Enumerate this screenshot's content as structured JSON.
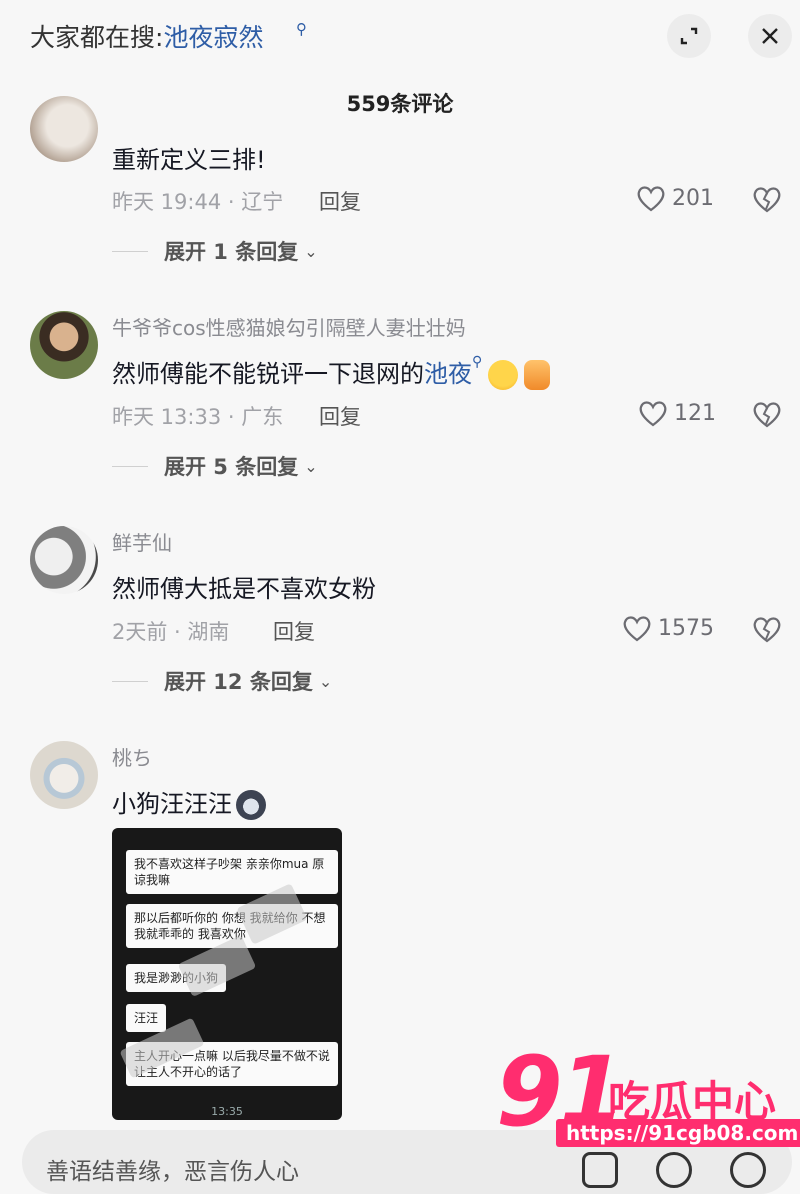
{
  "header": {
    "search_prefix": "大家都在搜:",
    "search_query": "池夜寂然",
    "comment_count": "559条评论"
  },
  "comments": [
    {
      "text": "重新定义三排!",
      "meta": "昨天 19:44 · 辽宁",
      "reply_label": "回复",
      "likes": "201",
      "expand_label": "展开 1 条回复"
    },
    {
      "username": "牛爷爷cos性感猫娘勾引隔壁人妻壮壮妈",
      "text_prefix": "然师傅能不能锐评一下退网的",
      "text_link": "池夜",
      "meta": "昨天 13:33 · 广东",
      "reply_label": "回复",
      "likes": "121",
      "expand_label": "展开 5 条回复"
    },
    {
      "username": "鲜芋仙",
      "text": "然师傅大抵是不喜欢女粉",
      "meta": "2天前 · 湖南",
      "reply_label": "回复",
      "likes": "1575",
      "expand_label": "展开 12 条回复"
    },
    {
      "username": "桃ち",
      "text": "小狗汪汪汪",
      "image_messages": [
        "我不喜欢这样子吵架 亲亲你mua 原谅我嘛",
        "那以后都听你的 你想 我就给你 不想我就乖乖的 我喜欢你",
        "我是渺渺的小狗",
        "汪汪",
        "主人开心一点嘛 以后我尽量不做不说让主人不开心的话了"
      ],
      "image_time": "13:35"
    }
  ],
  "bottom": {
    "input_placeholder": "善语结善缘，恶言伤人心"
  },
  "watermark": {
    "number": "91",
    "name": "吃瓜中心",
    "url": "https://91cgb08.com"
  },
  "colors": {
    "link": "#2e5da6",
    "watermark": "#ff2d6f",
    "background": "#f7f7f7"
  }
}
